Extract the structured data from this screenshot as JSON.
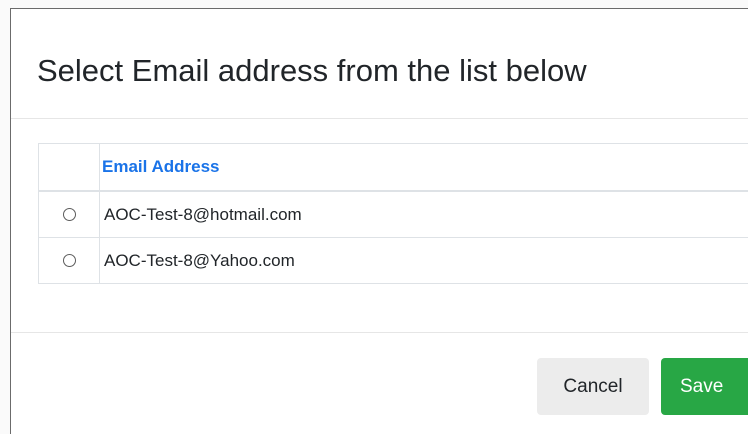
{
  "dialog": {
    "title": "Select Email address from the list below"
  },
  "table": {
    "columns": [
      "",
      "Email Address"
    ],
    "rows": [
      {
        "selected": false,
        "email": "AOC-Test-8@hotmail.com"
      },
      {
        "selected": false,
        "email": "AOC-Test-8@Yahoo.com"
      }
    ]
  },
  "footer": {
    "cancel_label": "Cancel",
    "save_label": "Save"
  },
  "colors": {
    "header_text": "#1a73e8",
    "save_button": "#28a745",
    "cancel_button": "#ececec"
  }
}
